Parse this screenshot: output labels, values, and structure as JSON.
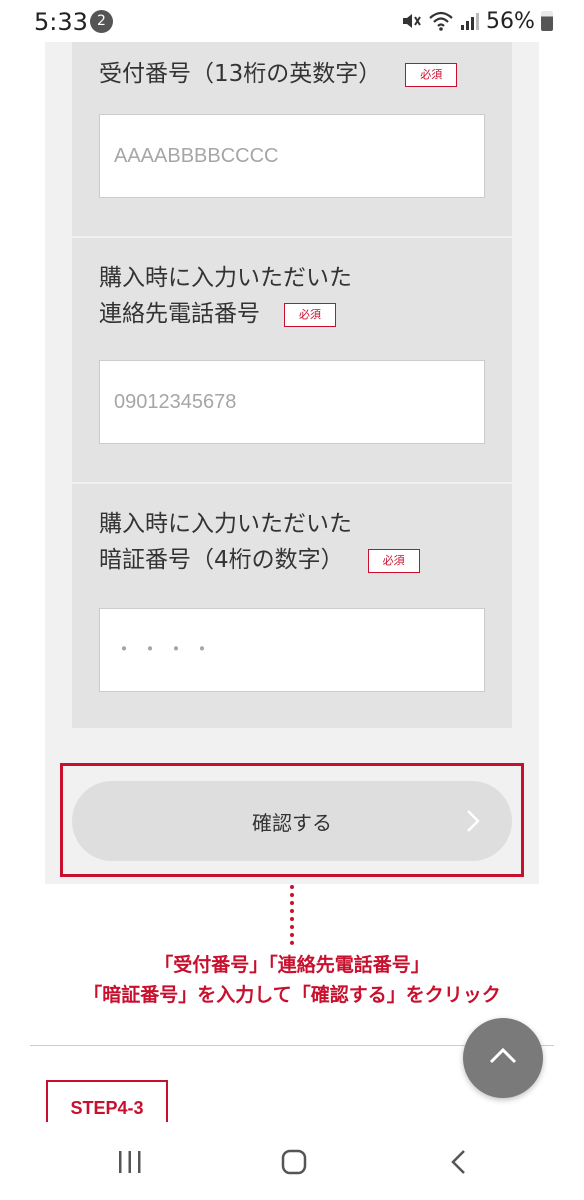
{
  "status_bar": {
    "time": "5:33",
    "notification_count": "2",
    "battery_percent": "56%",
    "icons": [
      "mute-icon",
      "wifi-icon",
      "signal-icon",
      "battery-icon"
    ]
  },
  "form": {
    "fields": [
      {
        "label_lines": [
          "受付番号（13桁の英数字）"
        ],
        "required_label": "必須",
        "placeholder": "AAAABBBBCCCC"
      },
      {
        "label_lines": [
          "購入時に入力いただいた",
          "連絡先電話番号"
        ],
        "required_label": "必須",
        "placeholder": "09012345678"
      },
      {
        "label_lines": [
          "購入時に入力いただいた",
          "暗証番号（4桁の数字）"
        ],
        "required_label": "必須",
        "placeholder": "・・・・"
      }
    ],
    "confirm_button_label": "確認する"
  },
  "annotation": {
    "line1": "「受付番号」「連絡先電話番号」",
    "line2": "「暗証番号」を入力して「確認する」をクリック"
  },
  "step": {
    "label": "STEP4-3"
  },
  "colors": {
    "accent": "#c8102e",
    "panel_bg": "#f1f1f1",
    "field_bg": "#e3e3e3",
    "button_bg": "#dedede",
    "scroll_button_bg": "#7a7a7a"
  }
}
